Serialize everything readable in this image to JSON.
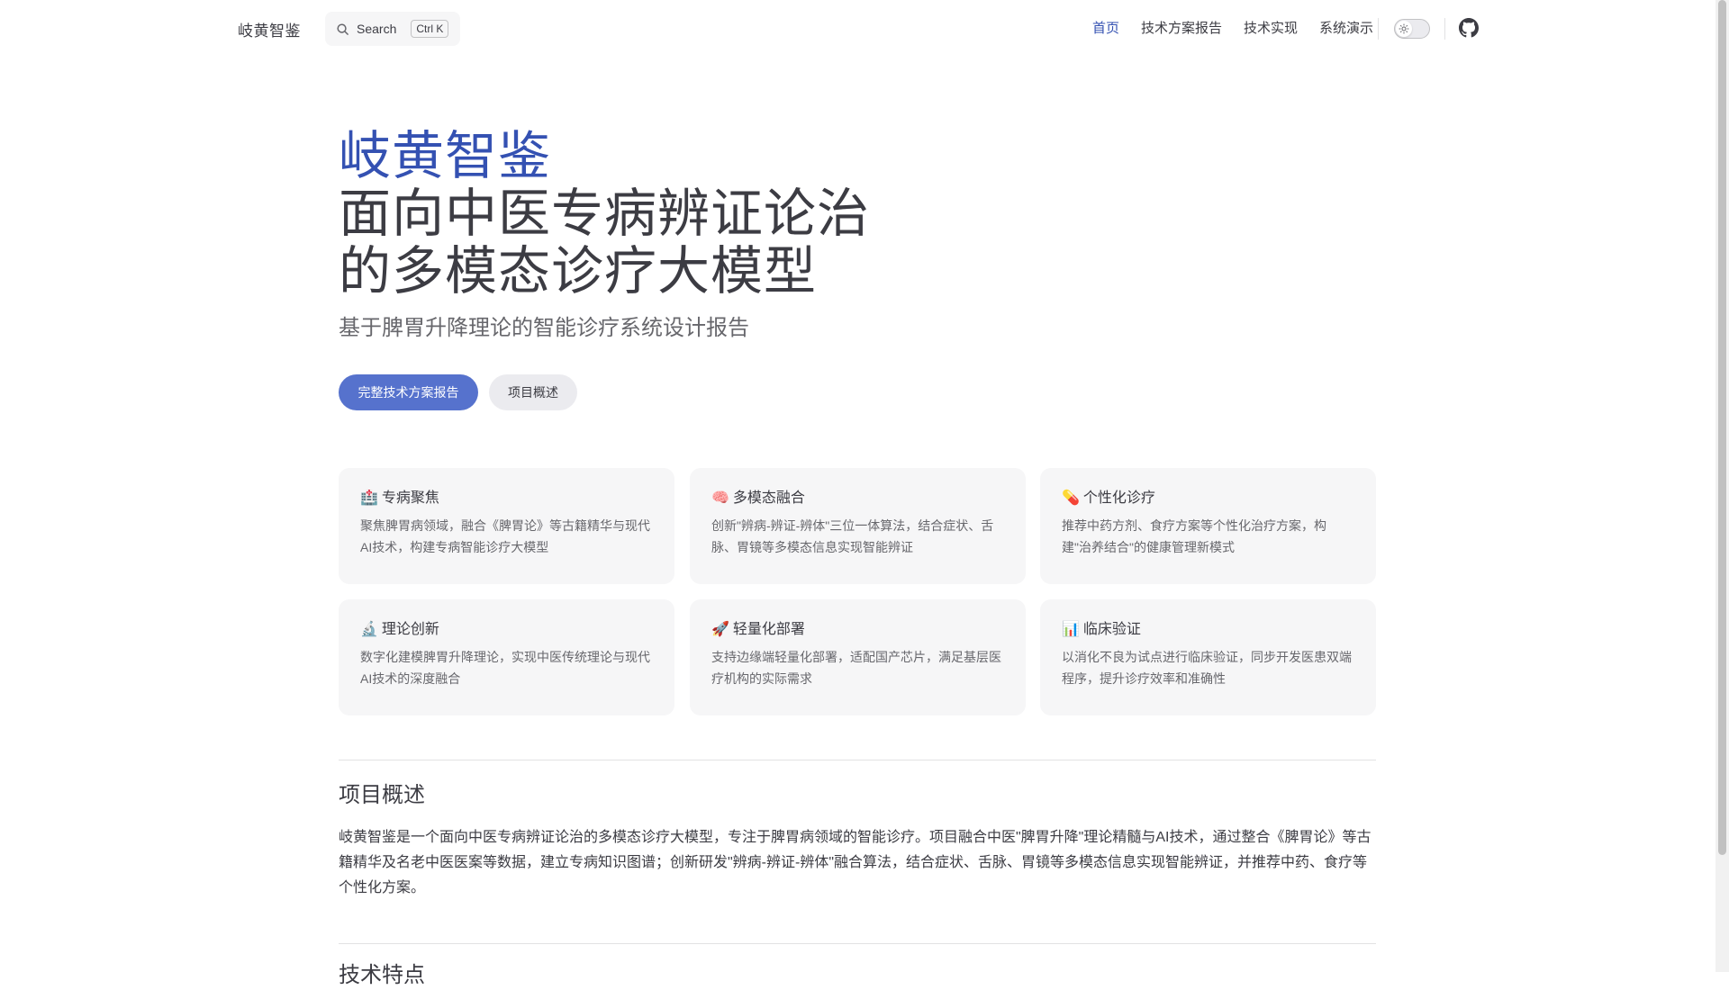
{
  "nav": {
    "brand": "岐黄智鉴",
    "search_label": "Search",
    "search_shortcut": "Ctrl K",
    "links": [
      {
        "label": "首页",
        "active": true
      },
      {
        "label": "技术方案报告",
        "active": false
      },
      {
        "label": "技术实现",
        "active": false
      },
      {
        "label": "系统演示",
        "active": false
      }
    ],
    "icons": {
      "theme_toggle": "sun-icon",
      "repo": "github-icon",
      "search": "search-icon"
    }
  },
  "hero": {
    "name": "岐黄智鉴",
    "text": "面向中医专病辨证论治的多模态诊疗大模型",
    "tagline": "基于脾胃升降理论的智能诊疗系统设计报告",
    "actions": [
      {
        "label": "完整技术方案报告",
        "theme": "brand"
      },
      {
        "label": "项目概述",
        "theme": "alt"
      }
    ]
  },
  "features": [
    {
      "emoji": "🏥",
      "title": "专病聚焦",
      "details": "聚焦脾胃病领域，融合《脾胃论》等古籍精华与现代AI技术，构建专病智能诊疗大模型"
    },
    {
      "emoji": "🧠",
      "title": "多模态融合",
      "details": "创新\"辨病-辨证-辨体\"三位一体算法，结合症状、舌脉、胃镜等多模态信息实现智能辨证"
    },
    {
      "emoji": "💊",
      "title": "个性化诊疗",
      "details": "推荐中药方剂、食疗方案等个性化治疗方案，构建\"治养结合\"的健康管理新模式"
    },
    {
      "emoji": "🔬",
      "title": "理论创新",
      "details": "数字化建模脾胃升降理论，实现中医传统理论与现代AI技术的深度融合"
    },
    {
      "emoji": "🚀",
      "title": "轻量化部署",
      "details": "支持边缘端轻量化部署，适配国产芯片，满足基层医疗机构的实际需求"
    },
    {
      "emoji": "📊",
      "title": "临床验证",
      "details": "以消化不良为试点进行临床验证，同步开发医患双端程序，提升诊疗效率和准确性"
    }
  ],
  "overview": {
    "title": "项目概述",
    "body": "岐黄智鉴是一个面向中医专病辨证论治的多模态诊疗大模型，专注于脾胃病领域的智能诊疗。项目融合中医\"脾胃升降\"理论精髓与AI技术，通过整合《脾胃论》等古籍精华及名老中医医案等数据，建立专病知识图谱；创新研发\"辨病-辨证-辨体\"融合算法，结合症状、舌脉、胃镜等多模态信息实现智能辨证，并推荐中药、食疗等个性化方案。",
    "next_title": "技术特点"
  },
  "colors": {
    "brand": "#3451b2",
    "brand_button": "#5672cd",
    "text": "#3c3c43",
    "muted": "#67676c",
    "card_bg": "#f6f6f7"
  }
}
